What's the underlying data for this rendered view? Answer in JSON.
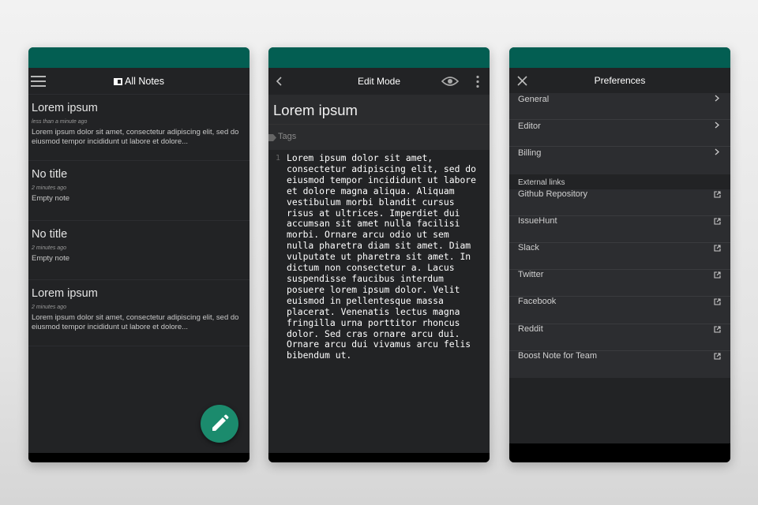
{
  "notes_screen": {
    "title": "All Notes",
    "notes": [
      {
        "title": "Lorem ipsum",
        "time": "less than a minute ago",
        "body": "Lorem ipsum dolor sit amet, consectetur adipiscing elit, sed do eiusmod tempor incididunt ut labore et dolore..."
      },
      {
        "title": "No title",
        "time": "2 minutes ago",
        "body": "Empty note"
      },
      {
        "title": "No title",
        "time": "2 minutes ago",
        "body": "Empty note"
      },
      {
        "title": "Lorem ipsum",
        "time": "2 minutes ago",
        "body": "Lorem ipsum dolor sit amet, consectetur adipiscing elit, sed do eiusmod tempor incididunt ut labore et dolore..."
      }
    ]
  },
  "editor_screen": {
    "title": "Edit Mode",
    "note_title": "Lorem ipsum",
    "tags_placeholder": "Tags",
    "line_number": "1",
    "content": "Lorem ipsum dolor sit amet,\nconsectetur adipiscing elit, sed do\neiusmod tempor incididunt ut labore\net dolore magna aliqua. Aliquam\nvestibulum morbi blandit cursus\nrisus at ultrices. Imperdiet dui\naccumsan sit amet nulla facilisi\nmorbi. Ornare arcu odio ut sem\nnulla pharetra diam sit amet. Diam\nvulputate ut pharetra sit amet. In\ndictum non consectetur a. Lacus\nsuspendisse faucibus interdum\nposuere lorem ipsum dolor. Velit\neuismod in pellentesque massa\nplacerat. Venenatis lectus magna\nfringilla urna porttitor rhoncus\ndolor. Sed cras ornare arcu dui.\nOrnare arcu dui vivamus arcu felis\nbibendum ut."
  },
  "preferences_screen": {
    "title": "Preferences",
    "settings": [
      {
        "label": "General"
      },
      {
        "label": "Editor"
      },
      {
        "label": "Billing"
      }
    ],
    "external_links_header": "External links",
    "external_links": [
      {
        "label": "Github Repository"
      },
      {
        "label": "IssueHunt"
      },
      {
        "label": "Slack"
      },
      {
        "label": "Twitter"
      },
      {
        "label": "Facebook"
      },
      {
        "label": "Reddit"
      },
      {
        "label": "Boost Note for Team"
      }
    ]
  },
  "colors": {
    "status_bar": "#035e52",
    "fab": "#1b8b6d",
    "background": "#222325"
  }
}
